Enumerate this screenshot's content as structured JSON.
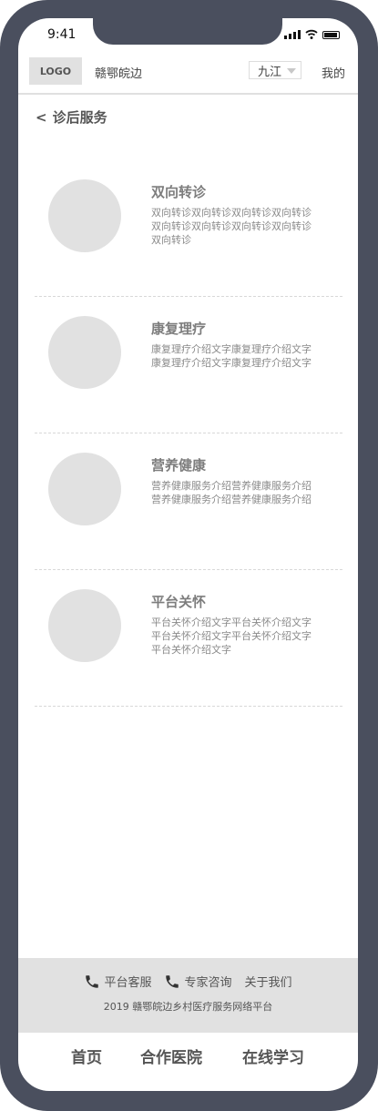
{
  "status_bar": {
    "time": "9:41"
  },
  "header": {
    "logo": "LOGO",
    "site_name": "赣鄂皖边",
    "city": "九江",
    "mine": "我的"
  },
  "page": {
    "back": "<",
    "title": "诊后服务"
  },
  "services": [
    {
      "title": "双向转诊",
      "description": "双向转诊双向转诊双向转诊双向转诊双向转诊双向转诊双向转诊双向转诊双向转诊"
    },
    {
      "title": "康复理疗",
      "description": "康复理疗介绍文字康复理疗介绍文字康复理疗介绍文字康复理疗介绍文字"
    },
    {
      "title": "营养健康",
      "description": "营养健康服务介绍营养健康服务介绍营养健康服务介绍营养健康服务介绍"
    },
    {
      "title": "平台关怀",
      "description": "平台关怀介绍文字平台关怀介绍文字平台关怀介绍文字平台关怀介绍文字平台关怀介绍文字"
    }
  ],
  "footer": {
    "links": {
      "customer_service": "平台客服",
      "expert_consult": "专家咨询",
      "about": "关于我们"
    },
    "copyright": "2019 赣鄂皖边乡村医疗服务网络平台"
  },
  "bottom_nav": {
    "home": "首页",
    "partner_hospitals": "合作医院",
    "online_learning": "在线学习"
  },
  "icons": {
    "phone": "phone-icon",
    "caret": "caret-down-icon"
  }
}
